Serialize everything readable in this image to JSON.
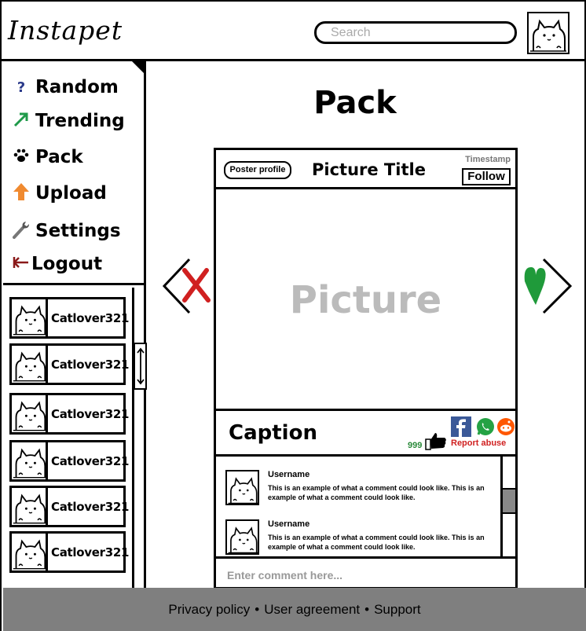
{
  "header": {
    "logo": "Instapet",
    "search_placeholder": "Search"
  },
  "sidebar": {
    "nav": [
      {
        "label": "Random",
        "icon": "question-icon",
        "color": "#2b3a8a"
      },
      {
        "label": "Trending",
        "icon": "trending-arrow-icon",
        "color": "#1f9a4a"
      },
      {
        "label": "Pack",
        "icon": "paw-icon",
        "color": "#000000"
      },
      {
        "label": "Upload",
        "icon": "upload-arrow-icon",
        "color": "#f08a30"
      },
      {
        "label": "Settings",
        "icon": "wrench-icon",
        "color": "#777777"
      },
      {
        "label": "Logout",
        "icon": "logout-arrow-icon",
        "color": "#8a1a1a"
      }
    ],
    "contacts": [
      {
        "name": "Catlover321"
      },
      {
        "name": "Catlover321"
      },
      {
        "name": "Catlover321"
      },
      {
        "name": "Catlover321"
      },
      {
        "name": "Catlover321"
      },
      {
        "name": "Catlover321"
      }
    ]
  },
  "main": {
    "page_title": "Pack",
    "post": {
      "poster_profile": "Poster profile",
      "title": "Picture Title",
      "timestamp": "Timestamp",
      "follow": "Follow",
      "picture": "Picture",
      "caption": "Caption",
      "likes": "999",
      "report": "Report abuse",
      "comments": [
        {
          "user": "Username",
          "text": "This is an example of what a comment could look like. This is an example of what a comment could look like."
        },
        {
          "user": "Username",
          "text": "This is an example of what a comment could look like. This is an example of what a comment could look like."
        }
      ],
      "comment_placeholder": "Enter comment here..."
    }
  },
  "footer": {
    "links": [
      "Privacy policy",
      "User agreement",
      "Support"
    ],
    "separator": "•"
  },
  "colors": {
    "reject": "#d02020",
    "like_heart": "#1f9a3a",
    "footer_bg": "#7f7f7f",
    "facebook": "#3b5998",
    "whatsapp": "#25a244",
    "reddit": "#ff5700"
  }
}
